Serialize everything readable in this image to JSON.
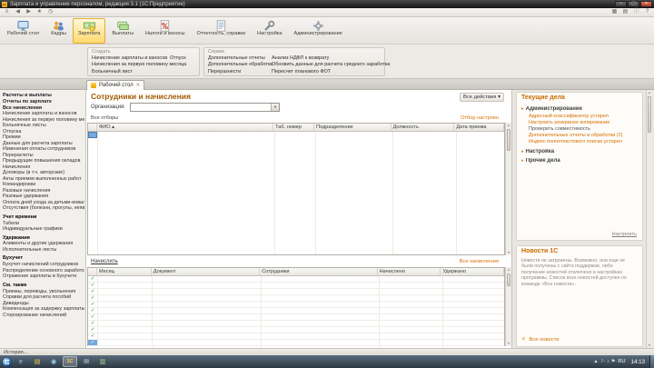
{
  "colors": {
    "accent_orange": "#d96f00",
    "selected_tab_yellow": "#ffd96e",
    "title_brown": "#a05a00",
    "check_green": "#1f8a1f",
    "selection_blue": "#74a9dc"
  },
  "window": {
    "title": "Зарплата и управление персоналом, редакция 3.1 (1С:Предприятие)",
    "controls": {
      "minimize": "–",
      "maximize": "▢",
      "close": "✕"
    }
  },
  "toolbar": {
    "left_icons": [
      {
        "name": "main-menu-icon",
        "glyph": "≡"
      },
      {
        "name": "back-icon",
        "glyph": "◀"
      },
      {
        "name": "forward-icon",
        "glyph": "▶"
      },
      {
        "name": "favorites-icon",
        "glyph": "★"
      },
      {
        "name": "history-icon",
        "glyph": "◷"
      }
    ],
    "right_icons": [
      {
        "name": "calculator-icon",
        "glyph": "▦"
      },
      {
        "name": "calendar-icon",
        "glyph": "▤"
      },
      {
        "name": "info-icon",
        "glyph": "ⓘ"
      },
      {
        "name": "help-icon",
        "glyph": "?"
      }
    ]
  },
  "ribbon": {
    "tabs": [
      {
        "label": "Рабочий стол",
        "selected": false
      },
      {
        "label": "Кадры",
        "selected": false
      },
      {
        "label": "Зарплата",
        "selected": true
      },
      {
        "label": "Выплаты",
        "selected": false
      },
      {
        "label": "Налоги и взносы",
        "selected": false
      },
      {
        "label": "Отчетность, справки",
        "selected": false
      },
      {
        "label": "Настройка",
        "selected": false
      },
      {
        "label": "Администрирование",
        "selected": false
      }
    ]
  },
  "actions_panel": {
    "create_group": {
      "title": "Создать",
      "links_col1": [
        "Начисление зарплаты и взносов",
        "Начисления за первую половину месяца",
        "Больничный лист"
      ],
      "links_col2": [
        "Отпуск"
      ]
    },
    "service_group": {
      "title": "Сервис",
      "links_col1": [
        "Дополнительные отчеты",
        "Дополнительные обработки",
        "Переразнести"
      ],
      "links_col2": [
        "Анализ НДФЛ к возврату",
        "Обновить данные для расчета среднего заработка",
        "Пересчет планового ФОТ"
      ]
    }
  },
  "tab_bar": {
    "active_tab": "Рабочий стол",
    "close_glyph": "✕"
  },
  "sidebar": {
    "items": [
      {
        "t": "b",
        "label": "Расчеты и выплаты"
      },
      {
        "t": "b",
        "label": "Отчеты по зарплате"
      },
      {
        "t": "b",
        "label": "Все начисления"
      },
      {
        "t": "l",
        "label": "Начисление зарплаты и взносов"
      },
      {
        "t": "l",
        "label": "Начисления за первую половину месяца"
      },
      {
        "t": "l",
        "label": "Больничные листы"
      },
      {
        "t": "l",
        "label": "Отпуска"
      },
      {
        "t": "l",
        "label": "Премии"
      },
      {
        "t": "l",
        "label": "Данные для расчета зарплаты"
      },
      {
        "t": "l",
        "label": "Изменения оплаты сотрудников"
      },
      {
        "t": "l",
        "label": "Перерасчеты"
      },
      {
        "t": "l",
        "label": "Предыдущие повышения окладов"
      },
      {
        "t": "l",
        "label": "Начисления"
      },
      {
        "t": "l",
        "label": "Договоры (в т.ч. авторские)"
      },
      {
        "t": "l",
        "label": "Акты приемки выполненных работ"
      },
      {
        "t": "l",
        "label": "Командировки"
      },
      {
        "t": "l",
        "label": "Разовые начисления"
      },
      {
        "t": "l",
        "label": "Разовые удержания"
      },
      {
        "t": "l",
        "label": "Оплата дней ухода за детьми-инвалидами"
      },
      {
        "t": "l",
        "label": "Отсутствия (болезни, прогулы, неявки)"
      },
      {
        "t": "h",
        "label": "Учет времени"
      },
      {
        "t": "l",
        "label": "Табели"
      },
      {
        "t": "l",
        "label": "Индивидуальные графики"
      },
      {
        "t": "h",
        "label": "Удержания"
      },
      {
        "t": "l",
        "label": "Алименты и другие удержания"
      },
      {
        "t": "l",
        "label": "Исполнительные листы"
      },
      {
        "t": "h",
        "label": "Бухучет"
      },
      {
        "t": "l",
        "label": "Бухучет начислений сотрудников"
      },
      {
        "t": "l",
        "label": "Распределение основного заработка"
      },
      {
        "t": "l",
        "label": "Отражение зарплаты в бухучете"
      },
      {
        "t": "h",
        "label": "См. также"
      },
      {
        "t": "l",
        "label": "Приемы, переводы, увольнения"
      },
      {
        "t": "l",
        "label": "Справки для расчета пособий"
      },
      {
        "t": "l",
        "label": "Дивиденды"
      },
      {
        "t": "l",
        "label": "Компенсация за задержку зарплаты"
      },
      {
        "t": "l",
        "label": "Сторнирование начислений"
      }
    ]
  },
  "main": {
    "title": "Сотрудники и начисления",
    "all_actions_label": "Все действия",
    "org_label": "Организация:",
    "org_value": "",
    "filter_left": "Все отборы",
    "filter_right": "Отбор настроен",
    "employees_table": {
      "columns": [
        "ФИО",
        "Таб. номер",
        "Подразделение",
        "Должность",
        "Дата приема"
      ]
    },
    "accrue_link": "Начислить",
    "all_accruals_link": "Все начисления",
    "accruals_table": {
      "columns": [
        "Месяц",
        "Документ",
        "Сотрудники",
        "Начислено",
        "Удержано"
      ],
      "row_count": 11
    }
  },
  "todo_panel": {
    "title": "Текущие дела",
    "groups": [
      {
        "label": "Администрирование",
        "items": [
          {
            "label": "Адресный классификатор устарел",
            "style": "link"
          },
          {
            "label": "Настроить резервное копирование",
            "style": "link"
          },
          {
            "label": "Проверить совместимость",
            "style": "text"
          },
          {
            "label": "Дополнительные отчеты и обработки (2)",
            "style": "link"
          },
          {
            "label": "Индекс полнотекстового поиска устарел",
            "style": "link"
          }
        ]
      },
      {
        "label": "Настройка",
        "items": []
      },
      {
        "label": "Прочие дела",
        "items": []
      }
    ],
    "configure_link": "Настроить"
  },
  "news_panel": {
    "title": "Новости 1С",
    "body": "Новости не загружены. Возможно, они еще не были получены с сайта поддержки, либо получение новостей отключено в настройках программы. Список всех новостей доступен по команде «Все новости».",
    "all_news_link": "Все новости"
  },
  "status_bar": {
    "history_label": "История..."
  },
  "taskbar": {
    "apps": [
      {
        "name": "internet-explorer",
        "glyph": "e",
        "color": "#8fd0f5"
      },
      {
        "name": "explorer-folder",
        "glyph": "▤",
        "color": "#f2c94c"
      },
      {
        "name": "media-player",
        "glyph": "◉",
        "color": "#9ad4f0"
      },
      {
        "name": "1c-enterprise",
        "glyph": "1С",
        "color": "#ffd34e",
        "active": true
      },
      {
        "name": "mail",
        "glyph": "✉",
        "color": "#e6edf4"
      },
      {
        "name": "documents",
        "glyph": "▥",
        "color": "#a8d890"
      }
    ],
    "tray": {
      "hidden_arrow": "▲",
      "language": "RU",
      "tray_icons": [
        {
          "name": "network-icon",
          "glyph": "⚐"
        },
        {
          "name": "volume-icon",
          "glyph": "♪"
        },
        {
          "name": "action-center-icon",
          "glyph": "⚑"
        }
      ],
      "time": "14:13"
    }
  },
  "icons": {
    "logo": "1С",
    "check": "✓",
    "triangle": "▸",
    "dropdown": "▾",
    "sort_asc": "▴",
    "arrow_up": "▲",
    "arrow_down": "▼",
    "news_star": "✳"
  }
}
